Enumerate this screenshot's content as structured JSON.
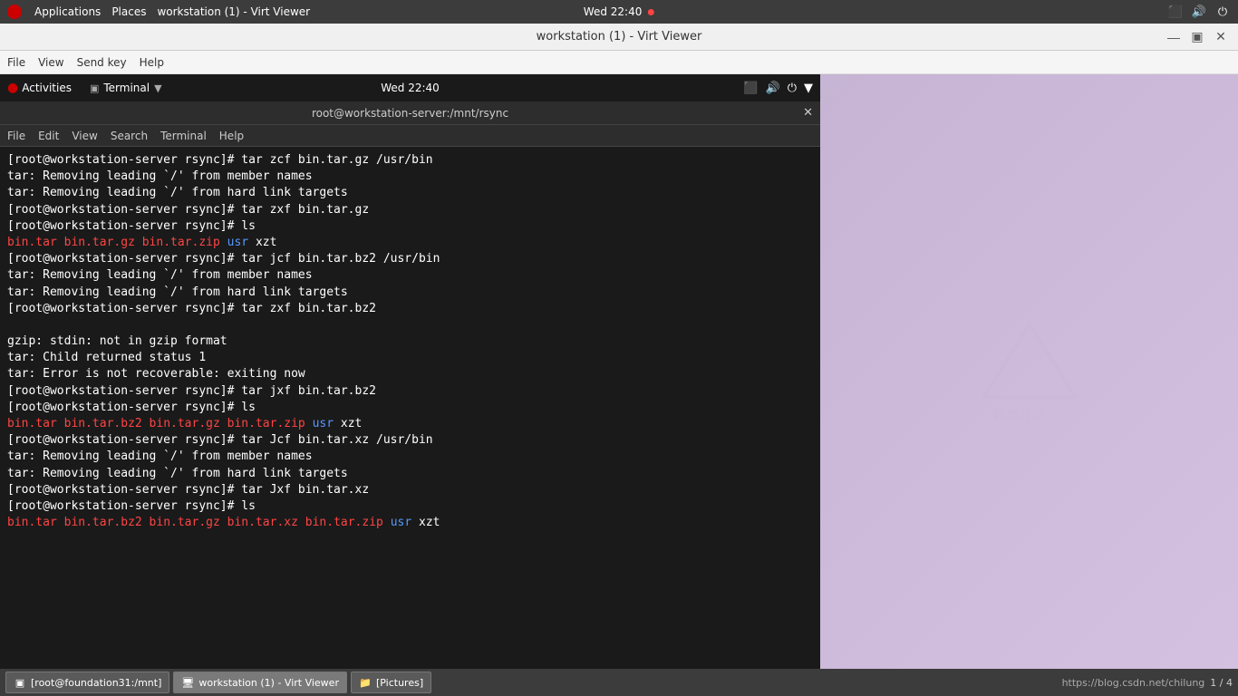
{
  "system_bar": {
    "app_label": "Applications",
    "places_label": "Places",
    "window_title": "workstation (1) - Virt Viewer",
    "time": "Wed 22:40",
    "icons": {
      "network": "network-icon",
      "volume": "volume-icon",
      "power": "power-icon"
    }
  },
  "window": {
    "title": "workstation (1) - Virt Viewer",
    "menu": {
      "file": "File",
      "view": "View",
      "send_key": "Send key",
      "help": "Help"
    }
  },
  "inner_gnome": {
    "activities": "Activities",
    "terminal": "Terminal",
    "time": "Wed 22:40"
  },
  "terminal": {
    "title": "root@workstation-server:/mnt/rsync",
    "menu": {
      "file": "File",
      "edit": "Edit",
      "view": "View",
      "search": "Search",
      "terminal": "Terminal",
      "help": "Help"
    },
    "lines": [
      {
        "type": "prompt",
        "text": "[root@workstation-server rsync]# tar zcf bin.tar.gz /usr/bin"
      },
      {
        "type": "output",
        "text": "tar: Removing leading `/' from member names"
      },
      {
        "type": "output",
        "text": "tar: Removing leading `/' from hard link targets"
      },
      {
        "type": "prompt",
        "text": "[root@workstation-server rsync]# tar zxf bin.tar.gz"
      },
      {
        "type": "prompt",
        "text": "[root@workstation-server rsync]# ls"
      },
      {
        "type": "files",
        "files": [
          {
            "name": "bin.tar",
            "color": "red"
          },
          {
            "name": "bin.tar.gz",
            "color": "red"
          },
          {
            "name": "bin.tar.zip",
            "color": "red"
          },
          {
            "name": "usr",
            "color": "blue"
          },
          {
            "name": "xzt",
            "color": "white"
          }
        ]
      },
      {
        "type": "prompt",
        "text": "[root@workstation-server rsync]# tar jcf bin.tar.bz2 /usr/bin"
      },
      {
        "type": "output",
        "text": "tar: Removing leading `/' from member names"
      },
      {
        "type": "output",
        "text": "tar: Removing leading `/' from hard link targets"
      },
      {
        "type": "prompt",
        "text": "[root@workstation-server rsync]# tar zxf bin.tar.bz2"
      },
      {
        "type": "blank"
      },
      {
        "type": "output",
        "text": "gzip: stdin: not in gzip format"
      },
      {
        "type": "output",
        "text": "tar: Child returned status 1"
      },
      {
        "type": "output",
        "text": "tar: Error is not recoverable: exiting now"
      },
      {
        "type": "prompt",
        "text": "[root@workstation-server rsync]# tar jxf bin.tar.bz2"
      },
      {
        "type": "prompt",
        "text": "[root@workstation-server rsync]# ls"
      },
      {
        "type": "files",
        "files": [
          {
            "name": "bin.tar",
            "color": "red"
          },
          {
            "name": "bin.tar.bz2",
            "color": "red"
          },
          {
            "name": "bin.tar.gz",
            "color": "red"
          },
          {
            "name": "bin.tar.zip",
            "color": "red"
          },
          {
            "name": "usr",
            "color": "blue"
          },
          {
            "name": "xzt",
            "color": "white"
          }
        ]
      },
      {
        "type": "prompt",
        "text": "[root@workstation-server rsync]# tar Jcf bin.tar.xz /usr/bin"
      },
      {
        "type": "output",
        "text": "tar: Removing leading `/' from member names"
      },
      {
        "type": "output",
        "text": "tar: Removing leading `/' from hard link targets"
      },
      {
        "type": "prompt",
        "text": "[root@workstation-server rsync]# tar Jxf bin.tar.xz"
      },
      {
        "type": "prompt",
        "text": "[root@workstation-server rsync]# ls"
      },
      {
        "type": "files",
        "files": [
          {
            "name": "bin.tar",
            "color": "red"
          },
          {
            "name": "bin.tar.bz2",
            "color": "red"
          },
          {
            "name": "bin.tar.gz",
            "color": "red"
          },
          {
            "name": "bin.tar.xz",
            "color": "red"
          },
          {
            "name": "bin.tar.zip",
            "color": "red"
          },
          {
            "name": "usr",
            "color": "blue"
          },
          {
            "name": "xzt",
            "color": "white"
          }
        ]
      }
    ]
  },
  "taskbar": {
    "items": [
      {
        "label": "[root@foundation31:/mnt]",
        "icon": "terminal-icon",
        "active": false
      },
      {
        "label": "workstation (1) - Virt Viewer",
        "icon": "virt-icon",
        "active": true
      },
      {
        "label": "[Pictures]",
        "icon": "folder-icon",
        "active": false
      }
    ],
    "url": "https://blog.csdn.net/chilung",
    "page": "1 / 4"
  }
}
